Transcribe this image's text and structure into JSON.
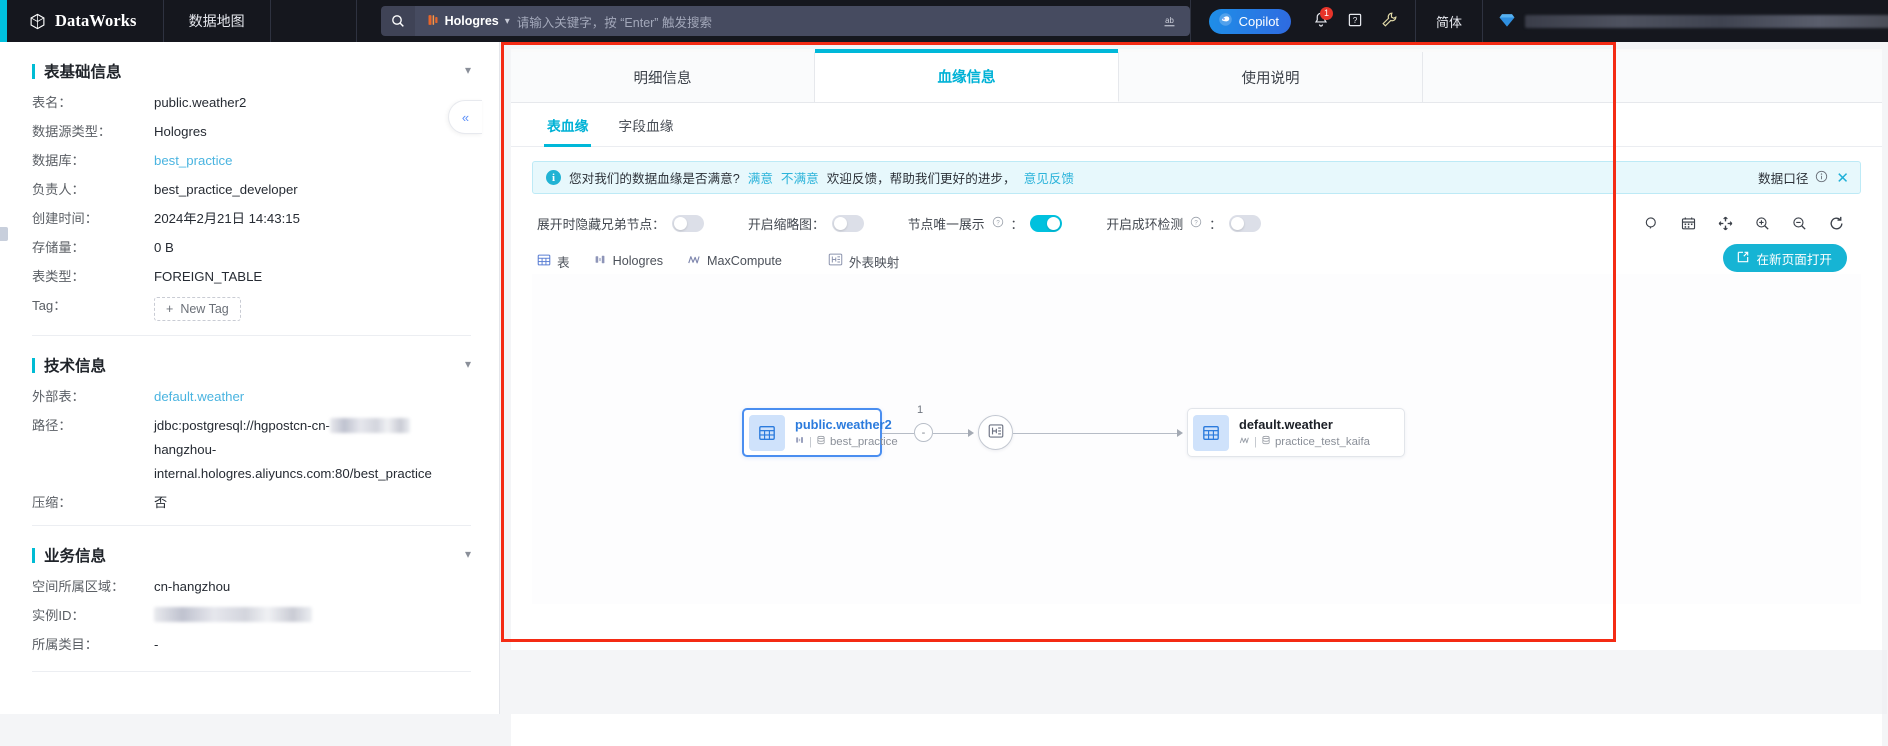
{
  "topbar": {
    "brand": "DataWorks",
    "brand_logo_icon": "dataworks-cube-logo",
    "nav_item": "数据地图",
    "search": {
      "search_icon": "search-icon",
      "engine_icon": "hologres-icon",
      "engine_label": "Hologres",
      "caret_icon": "chevron-down-icon",
      "placeholder": "请输入关键字，按 “Enter” 触发搜索",
      "tail_icon": "ab-translate-icon"
    },
    "copilot": {
      "label": "Copilot",
      "icon": "copilot-icon"
    },
    "bell": {
      "icon": "bell-icon",
      "badge": "1"
    },
    "help": {
      "icon": "help-question-icon"
    },
    "tool": {
      "icon": "wrench-icon"
    },
    "language": "简体",
    "avatar_icon": "user-diamond-avatar"
  },
  "left_panel": {
    "collapse_icon": "double-chevron-left-icon",
    "sections": [
      {
        "title": "表基础信息",
        "caret_icon": "chevron-down-icon",
        "rows": [
          {
            "key": "表名：",
            "value": "public.weather2",
            "style": "plain"
          },
          {
            "key": "数据源类型：",
            "value": "Hologres",
            "style": "plain"
          },
          {
            "key": "数据库：",
            "value": "best_practice",
            "style": "link"
          },
          {
            "key": "负责人：",
            "value": "best_practice_developer",
            "style": "plain"
          },
          {
            "key": "创建时间：",
            "value": "2024年2月21日 14:43:15",
            "style": "plain"
          },
          {
            "key": "存储量：",
            "value": "0 B",
            "style": "plain"
          },
          {
            "key": "表类型：",
            "value": "FOREIGN_TABLE",
            "style": "plain"
          },
          {
            "key": "Tag：",
            "value": "New Tag",
            "style": "tag"
          }
        ]
      },
      {
        "title": "技术信息",
        "caret_icon": "chevron-down-icon",
        "rows": [
          {
            "key": "外部表：",
            "value": "default.weather",
            "style": "link"
          },
          {
            "key": "路径：",
            "value": "jdbc:postgresql://hgpostcn-cn-",
            "style": "masked-path"
          },
          {
            "key": "",
            "value": "hangzhou-",
            "style": "plain"
          },
          {
            "key": "",
            "value": "internal.hologres.aliyuncs.com:80/best_practice",
            "style": "plain"
          },
          {
            "key": "压缩：",
            "value": "否",
            "style": "plain"
          }
        ]
      },
      {
        "title": "业务信息",
        "caret_icon": "chevron-down-icon",
        "rows": [
          {
            "key": "空间所属区域：",
            "value": "cn-hangzhou",
            "style": "plain"
          },
          {
            "key": "实例ID：",
            "value": "",
            "style": "masked"
          },
          {
            "key": "所属类目：",
            "value": "-",
            "style": "plain"
          }
        ]
      }
    ]
  },
  "main": {
    "tabs": [
      {
        "label": "明细信息",
        "active": false
      },
      {
        "label": "血缘信息",
        "active": true
      },
      {
        "label": "使用说明",
        "active": false
      }
    ],
    "subtabs": [
      {
        "label": "表血缘",
        "active": true
      },
      {
        "label": "字段血缘",
        "active": false
      }
    ],
    "banner": {
      "info_icon": "info-circle-icon",
      "question": "您对我们的数据血缘是否满意?",
      "satisfied": "满意",
      "unsatisfied": "不满意",
      "tail": "欢迎反馈，帮助我们更好的进步，",
      "feedback_link": "意见反馈",
      "right_label": "数据口径",
      "right_info_icon": "info-outline-icon",
      "close_icon": "close-x-icon"
    },
    "controls": [
      {
        "label": "展开时隐藏兄弟节点：",
        "on": false,
        "has_help": false
      },
      {
        "label": "开启缩略图：",
        "on": false,
        "has_help": false
      },
      {
        "label": "节点唯一展示",
        "on": true,
        "has_help": true,
        "suffix": "："
      },
      {
        "label": "开启成环检测",
        "on": false,
        "has_help": true,
        "suffix": "："
      }
    ],
    "graph_tools": [
      {
        "icon": "search-node-icon",
        "name": "search"
      },
      {
        "icon": "calendar-icon",
        "name": "calendar"
      },
      {
        "icon": "fit-screen-icon",
        "name": "fit-view"
      },
      {
        "icon": "zoom-in-icon",
        "name": "zoom-in"
      },
      {
        "icon": "zoom-out-icon",
        "name": "zoom-out"
      },
      {
        "icon": "refresh-icon",
        "name": "refresh"
      }
    ],
    "legend": [
      {
        "icon": "table-grid-icon",
        "label": "表"
      },
      {
        "icon": "hologres-icon",
        "label": "Hologres"
      },
      {
        "icon": "maxcompute-icon",
        "label": "MaxCompute"
      },
      {
        "icon": "external-table-mapping-icon",
        "label": "外表映射"
      }
    ],
    "new_page_button": {
      "label": "在新页面打开",
      "icon": "open-external-icon"
    }
  },
  "lineage": {
    "source_node": {
      "title": "public.weather2",
      "engine_icon": "hologres-icon",
      "db_icon": "database-icon",
      "db": "best_practice",
      "table_icon": "table-grid-icon",
      "selected": true
    },
    "edge_count": "1",
    "edge_circle_label": "-",
    "mid_node": {
      "icon": "external-table-mapping-icon"
    },
    "target_node": {
      "title": "default.weather",
      "engine_icon": "maxcompute-icon",
      "db_icon": "database-icon",
      "db": "practice_test_kaifa",
      "table_icon": "table-grid-icon",
      "selected": false
    }
  },
  "colors": {
    "accent": "#00b8d9",
    "link": "#2b7bdd",
    "highlight_border": "#f42b14",
    "topbar_bg": "#15171e",
    "node_icon_bg": "#cfe2fb"
  }
}
